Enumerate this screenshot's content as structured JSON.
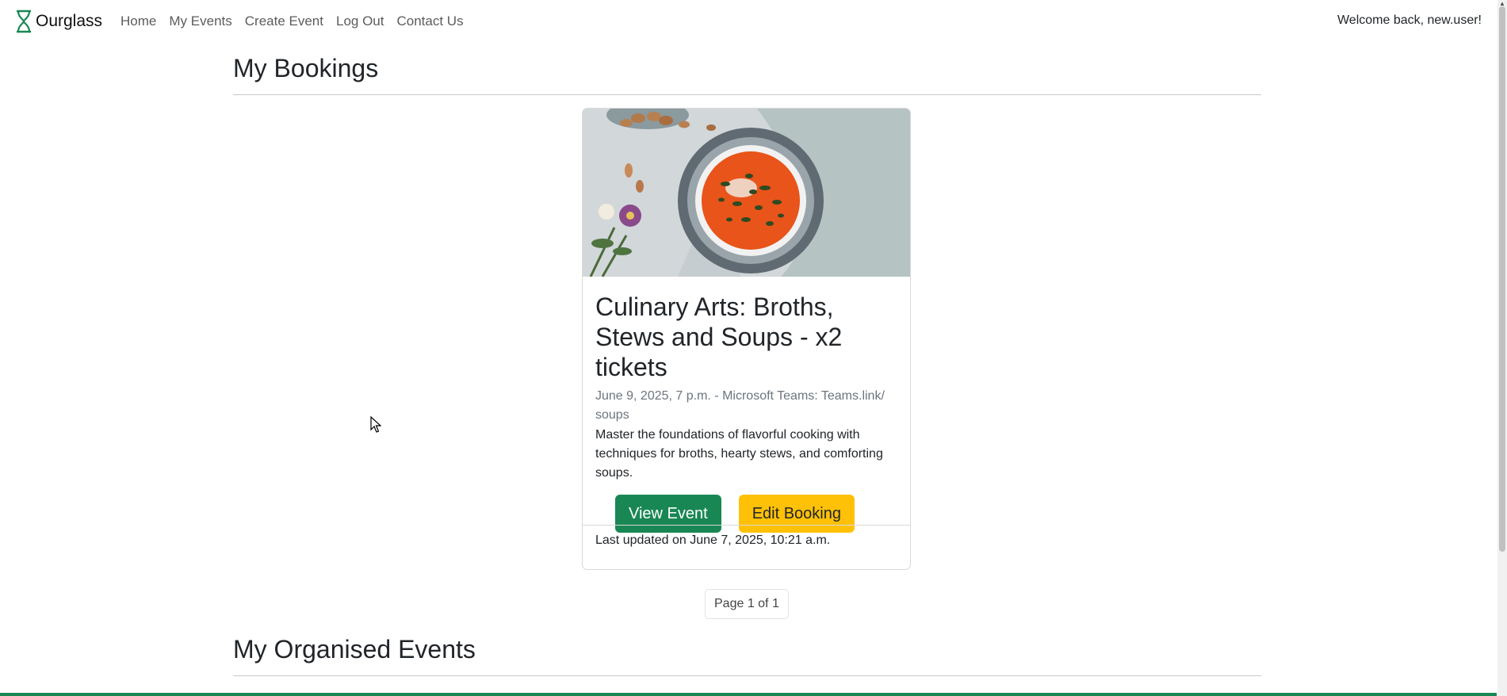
{
  "nav": {
    "brand": "Ourglass",
    "links": [
      "Home",
      "My Events",
      "Create Event",
      "Log Out",
      "Contact Us"
    ],
    "welcome": "Welcome back, new.user!"
  },
  "bookings": {
    "title": "My Bookings",
    "card": {
      "title": "Culinary Arts: Broths, Stews and Soups - x2 tickets",
      "meta": "June 9, 2025, 7 p.m. - Microsoft Teams: Teams.link/ soups",
      "description": "Master the foundations of flavorful cooking with techniques for broths, hearty stews, and comforting soups.",
      "view_label": "View Event",
      "edit_label": "Edit Booking",
      "footer": "Last updated on June 7, 2025, 10:21 a.m."
    },
    "pagination": "Page 1 of 1"
  },
  "organised": {
    "title": "My Organised Events"
  },
  "colors": {
    "primary_green": "#198754",
    "warning_yellow": "#ffc107",
    "soup_orange": "#e8541a"
  }
}
